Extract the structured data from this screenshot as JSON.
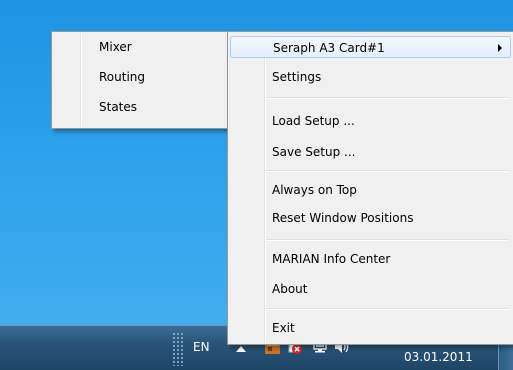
{
  "submenu": {
    "items": [
      {
        "label": "Mixer"
      },
      {
        "label": "Routing"
      },
      {
        "label": "States"
      }
    ]
  },
  "context_menu": {
    "items": [
      {
        "label": "Seraph A3 Card#1",
        "has_submenu": true
      },
      {
        "label": "Settings"
      },
      {
        "label": "Load Setup ..."
      },
      {
        "label": "Save Setup ..."
      },
      {
        "label": "Always on Top"
      },
      {
        "label": "Reset Window Positions"
      },
      {
        "label": "MARIAN Info Center"
      },
      {
        "label": "About"
      },
      {
        "label": "Exit"
      }
    ]
  },
  "taskbar": {
    "language": "EN",
    "date": "03.01.2011",
    "tray_icons": [
      "app-tray-icon",
      "action-center-error-icon",
      "network-icon",
      "volume-icon"
    ]
  },
  "colors": {
    "desktop": "#2a9fe9",
    "taskbar": "#2a5478",
    "menu_bg": "#f0f0f0",
    "highlight_border": "#aeccf1"
  }
}
